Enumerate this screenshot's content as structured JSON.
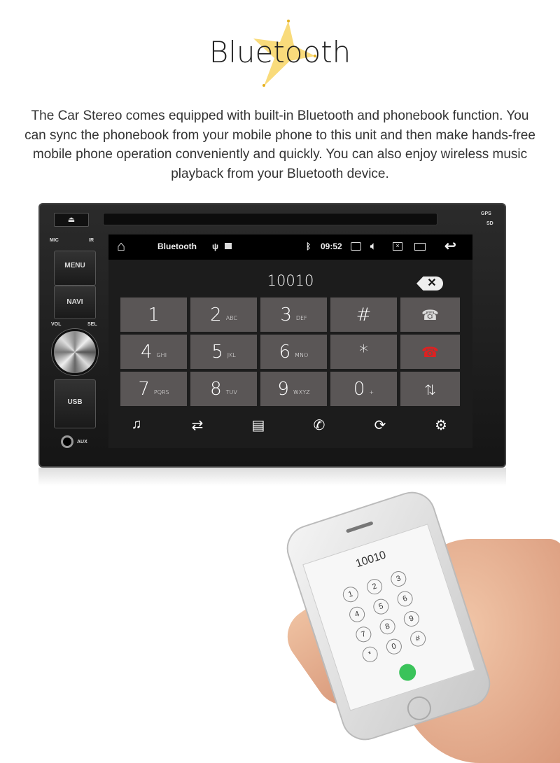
{
  "header": {
    "title": "Bluetooth",
    "accent": "#f5c518"
  },
  "description": "The Car Stereo comes equipped with built-in Bluetooth and phonebook function. You can sync the phonebook from your mobile phone to this unit and then make hands-free mobile phone operation conveniently and quickly. You can also enjoy wireless music playback from your Bluetooth device.",
  "stereo": {
    "panel": {
      "eject": "⏏",
      "mic": "MIC",
      "ir": "IR",
      "menu": "MENU",
      "navi": "NAVI",
      "vol": "VOL",
      "sel": "SEL",
      "usb": "USB",
      "aux": "AUX",
      "gps": "GPS",
      "sd": "SD"
    },
    "status_bar": {
      "app": "Bluetooth",
      "time": "09:52",
      "icons": [
        "home-icon",
        "usb-icon",
        "image-icon",
        "bluetooth-icon",
        "camera-icon",
        "volume-icon",
        "close-box-icon",
        "windows-icon",
        "back-icon"
      ]
    },
    "dial_number": "10010",
    "keys": [
      {
        "main": "1",
        "sub": ""
      },
      {
        "main": "2",
        "sub": "ABC"
      },
      {
        "main": "3",
        "sub": "DEF"
      },
      {
        "main": "#",
        "sub": ""
      },
      {
        "main": "☎",
        "sub": "",
        "icon": "call-icon"
      },
      {
        "main": "4",
        "sub": "GHI"
      },
      {
        "main": "5",
        "sub": "JKL"
      },
      {
        "main": "6",
        "sub": "MNO"
      },
      {
        "main": "*",
        "sub": ""
      },
      {
        "main": "☎",
        "sub": "",
        "icon": "hangup-icon"
      },
      {
        "main": "7",
        "sub": "PQRS"
      },
      {
        "main": "8",
        "sub": "TUV"
      },
      {
        "main": "9",
        "sub": "WXYZ"
      },
      {
        "main": "0",
        "sub": "+"
      },
      {
        "main": "⇅",
        "sub": "",
        "icon": "transfer-icon"
      }
    ],
    "bottom_bar": [
      "music-icon",
      "call-log-icon",
      "contacts-icon",
      "phone-icon",
      "sync-icon",
      "settings-icon"
    ]
  },
  "phone": {
    "number": "10010",
    "keys": [
      "1",
      "2",
      "3",
      "4",
      "5",
      "6",
      "7",
      "8",
      "9",
      "*",
      "0",
      "#"
    ]
  }
}
